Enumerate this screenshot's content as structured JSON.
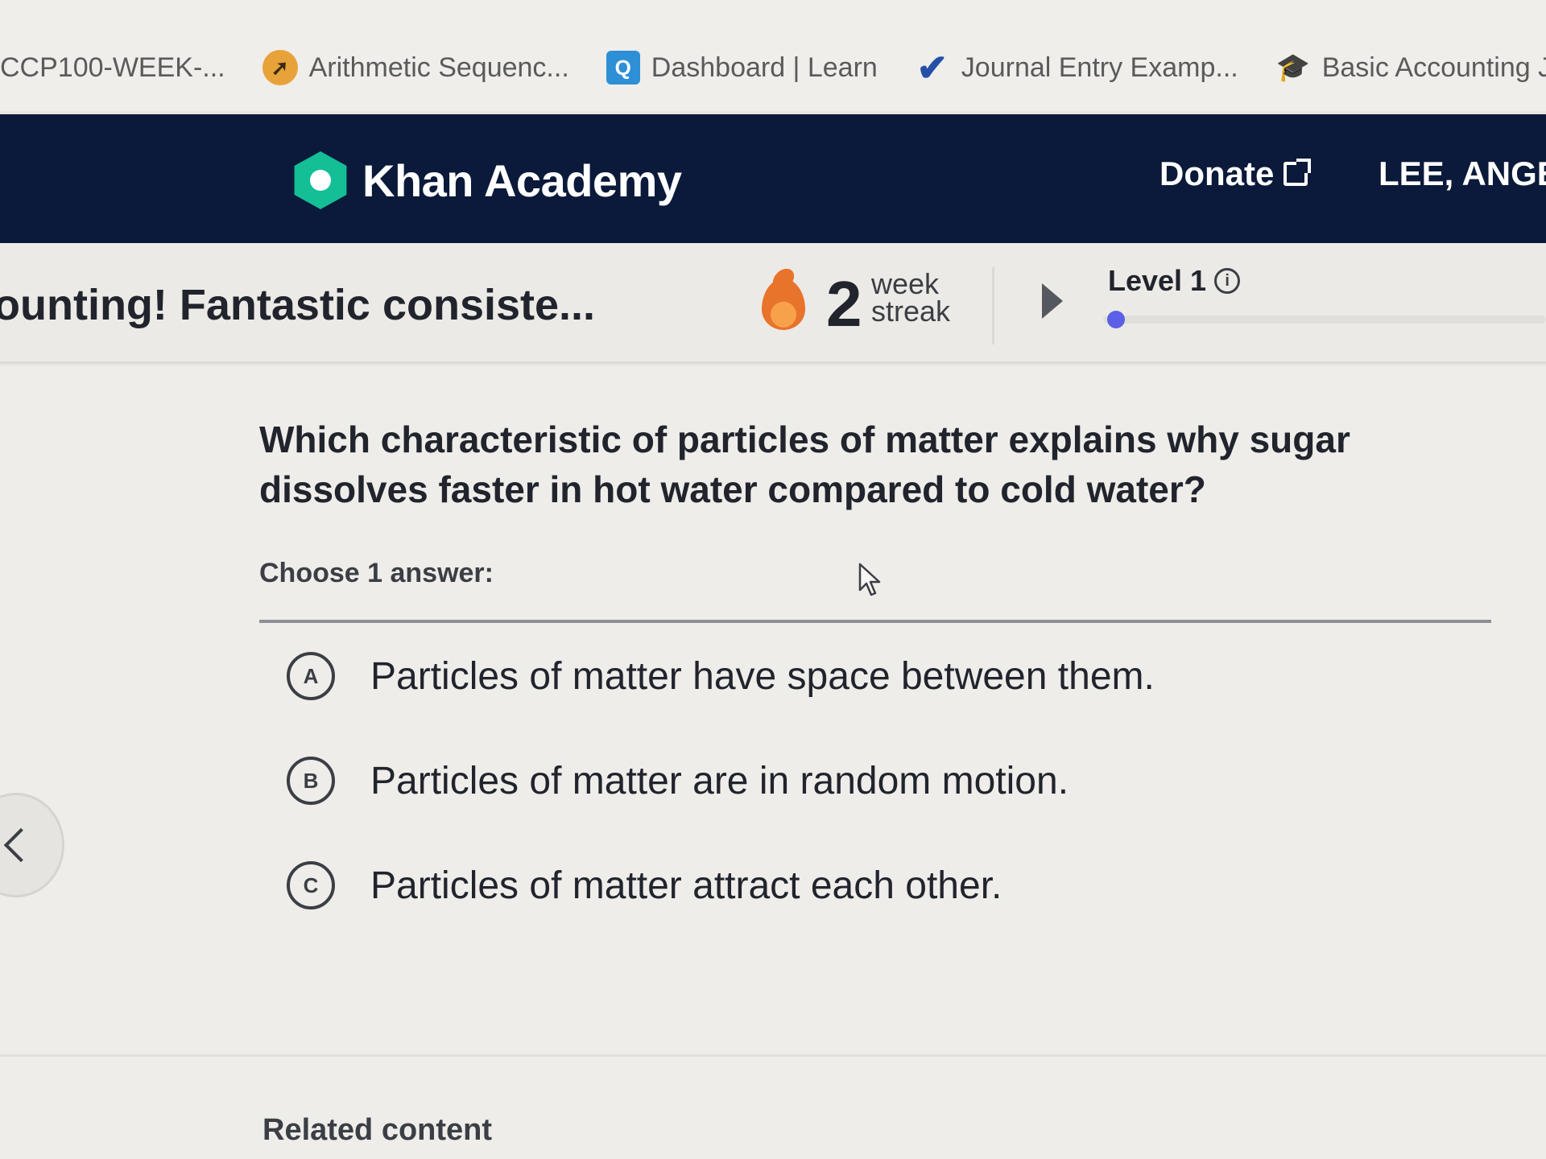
{
  "bookmarks": [
    {
      "label": "CCP100-WEEK-...",
      "icon": "none"
    },
    {
      "label": "Arithmetic Sequenc...",
      "icon": "rocket-icon"
    },
    {
      "label": "Dashboard | Learn",
      "icon": "q-logo-icon",
      "glyph": "Q"
    },
    {
      "label": "Journal Entry Examp...",
      "icon": "checkmark-icon",
      "glyph": "✔"
    },
    {
      "label": "Basic Accounting Jo...",
      "icon": "graduation-cap-icon",
      "glyph": "🎓"
    }
  ],
  "nav": {
    "brand": "Khan Academy",
    "donate": "Donate",
    "user": "LEE, ANGE"
  },
  "status": {
    "message": "ounting! Fantastic consiste...",
    "streak_count": "2",
    "streak_unit_line1": "week",
    "streak_unit_line2": "streak",
    "level": "Level 1",
    "level_progress": 0.02
  },
  "question": {
    "prompt": "Which characteristic of particles of matter explains why sugar dissolves faster in hot water compared to cold water?",
    "instruction": "Choose 1 answer:",
    "choices": [
      {
        "letter": "A",
        "text": "Particles of matter have space between them."
      },
      {
        "letter": "B",
        "text": "Particles of matter are in random motion."
      },
      {
        "letter": "C",
        "text": "Particles of matter attract each other."
      }
    ]
  },
  "footer": {
    "related": "Related content"
  },
  "colors": {
    "nav_bg": "#0b1a3a",
    "brand_green": "#14bf96",
    "level_dot": "#5b60e6",
    "streak_orange": "#e8732a"
  }
}
